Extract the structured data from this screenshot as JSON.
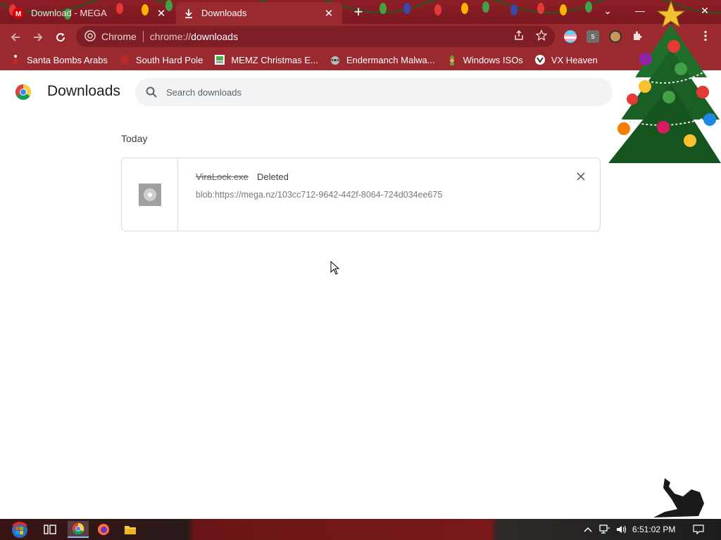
{
  "window": {
    "tabs": [
      {
        "label": "Download - MEGA",
        "active": false
      },
      {
        "label": "Downloads",
        "active": true
      }
    ],
    "new_tab_symbol": "+",
    "controls": {
      "tab_search": "⌄",
      "minimize": "—",
      "maximize": "☐",
      "close": "✕"
    }
  },
  "toolbar": {
    "site_label": "Chrome",
    "url_scheme": "chrome://",
    "url_host": "downloads",
    "icons": [
      "back-icon",
      "forward-icon",
      "reload-icon",
      "share-icon",
      "star-icon",
      "extensions-icon",
      "menu-icon"
    ]
  },
  "bookmarks": [
    {
      "label": "Santa Bombs Arabs",
      "icon": "santa-icon"
    },
    {
      "label": "South Hard Pole",
      "icon": "snowflake-icon"
    },
    {
      "label": "MEMZ Christmas E...",
      "icon": "memz-icon"
    },
    {
      "label": "Endermanch Malwa...",
      "icon": "raccoon-icon"
    },
    {
      "label": "Windows ISOs",
      "icon": "elf-icon"
    },
    {
      "label": "VX Heaven",
      "icon": "vx-icon"
    }
  ],
  "page": {
    "title": "Downloads",
    "search_placeholder": "Search downloads",
    "section_label": "Today",
    "items": [
      {
        "filename": "ViraLock.exe",
        "status": "Deleted",
        "url": "blob:https://mega.nz/103cc712-9642-442f-8064-724d034ee675"
      }
    ]
  },
  "taskbar": {
    "clock": "6:51:02 PM",
    "apps": [
      "start-button",
      "task-view-icon",
      "chrome-icon",
      "firefox-icon",
      "file-explorer-icon"
    ]
  },
  "colors": {
    "frame": "#9b2a30",
    "frame_dark": "#7a1720",
    "omnibox": "#7e1d25",
    "search_bg": "#f1f3f4"
  }
}
